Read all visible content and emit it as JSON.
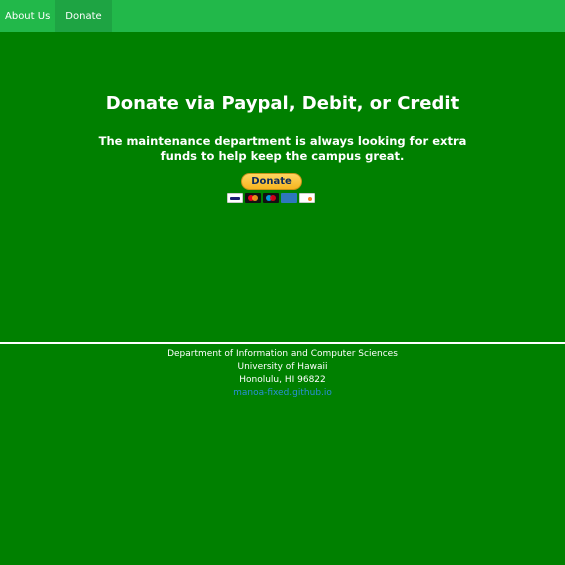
{
  "nav": {
    "items": [
      {
        "label": "About Us"
      },
      {
        "label": "Donate"
      }
    ]
  },
  "main": {
    "heading": "Donate via Paypal, Debit, or Credit",
    "description": "The maintenance department is always looking for extra funds to help keep the campus great.",
    "donate_label": "Donate",
    "card_icons": [
      "visa-card-icon",
      "mastercard-icon",
      "maestro-card-icon",
      "amex-card-icon",
      "discover-card-icon"
    ]
  },
  "footer": {
    "line1": "Department of Information and Computer Sciences",
    "line2": "University of Hawaii",
    "line3": "Honolulu, HI 96822",
    "link": "manoa-fixed.github.io"
  },
  "colors": {
    "background": "#008000",
    "navbar": "#22b84a",
    "nav_active": "#1ea443",
    "link": "#2a8fd6"
  }
}
